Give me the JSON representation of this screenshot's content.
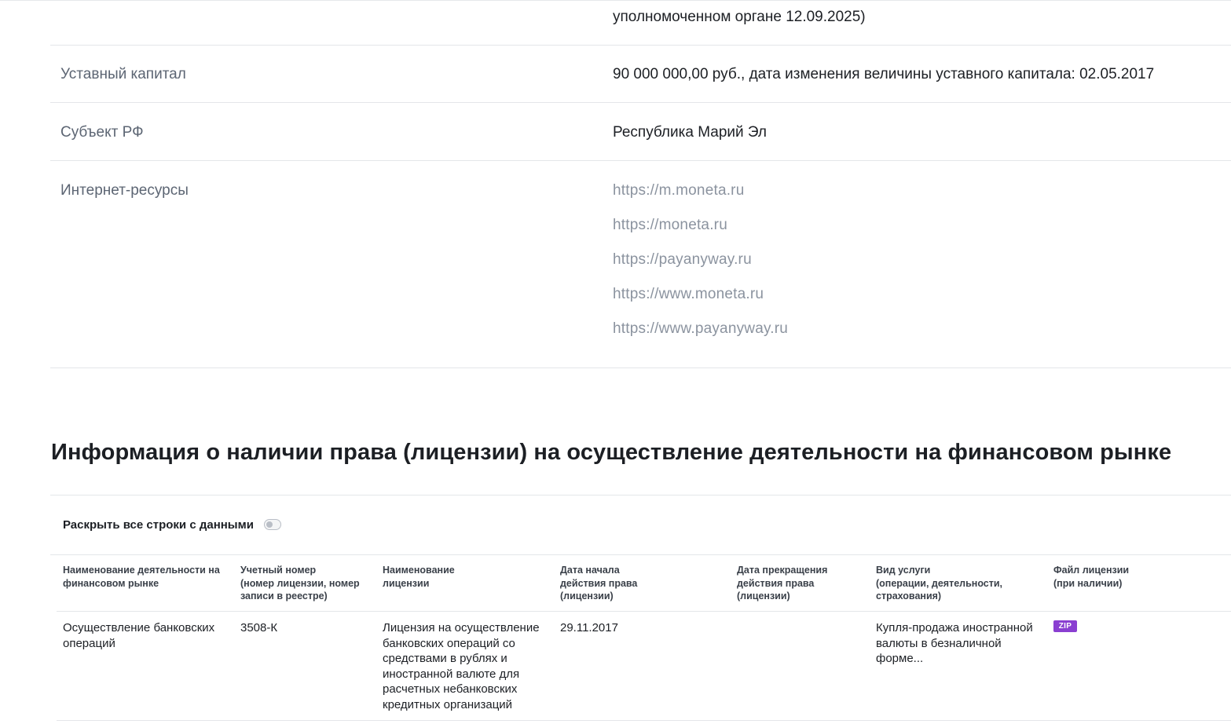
{
  "top_partial_text": "уполномоченном органе 12.09.2025)",
  "info_rows": {
    "capital": {
      "label": "Уставный капитал",
      "value": "90 000 000,00 руб., дата изменения величины уставного капитала: 02.05.2017"
    },
    "region": {
      "label": "Субъект РФ",
      "value": "Республика Марий Эл"
    },
    "internet": {
      "label": "Интернет-ресурсы",
      "links": [
        "https://m.moneta.ru",
        "https://moneta.ru",
        "https://payanyway.ru",
        "https://www.moneta.ru",
        "https://www.payanyway.ru"
      ]
    }
  },
  "license_section": {
    "title": "Информация о наличии права (лицензии) на осуществление деятельности на финансовом рынке",
    "toggle_label": "Раскрыть все строки с данными",
    "toggle_on": false,
    "columns": [
      "Наименование деятельности на\nфинансовом рынке",
      "Учетный номер\n(номер лицензии, номер\nзаписи в реестре)",
      "Наименование\nлицензии",
      "Дата начала\nдействия права\n(лицензии)",
      "Дата прекращения\nдействия права\n(лицензии)",
      "Вид услуги\n(операции, деятельности,\nстрахования)",
      "Файл лицензии\n(при наличии)"
    ],
    "rows": [
      {
        "activity": "Осуществление банковских операций",
        "number": "3508-К",
        "license_name": "Лицензия на осуществление банковских операций со средствами в рублях и иностранной валюте для расчетных небанковских кредитных организаций",
        "start_date": "29.11.2017",
        "end_date": "",
        "service": "Купля-продажа иностранной валюты в безналичной форме...",
        "file_badge": "ZIP"
      }
    ]
  },
  "colors": {
    "link": "#8b939f",
    "label": "#5c6573",
    "zip_badge": "#8a3fd1"
  }
}
